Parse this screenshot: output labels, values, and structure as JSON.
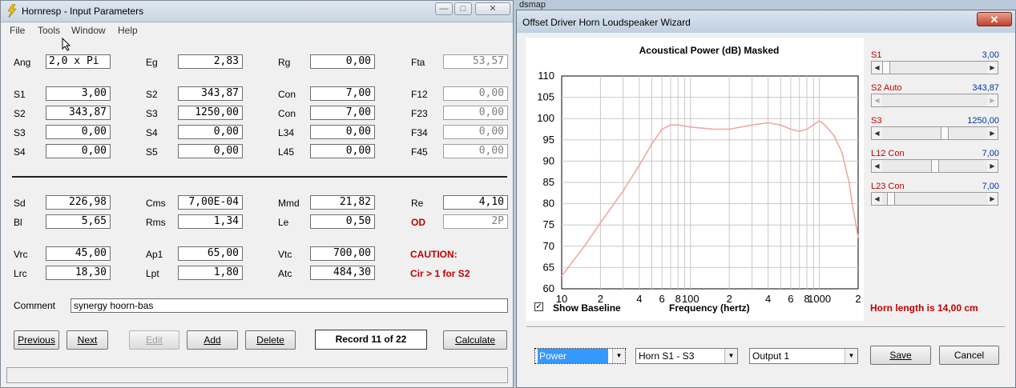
{
  "left": {
    "title": "Hornresp - Input Parameters",
    "menu": [
      "File",
      "Tools",
      "Window",
      "Help"
    ],
    "rows": [
      [
        {
          "label": "Ang",
          "value": "2,0 x Pi",
          "mono": true,
          "align": "left"
        },
        {
          "label": "Eg",
          "value": "2,83"
        },
        {
          "label": "Rg",
          "value": "0,00"
        },
        {
          "label": "Fta",
          "value": "53,57",
          "ro": true
        }
      ],
      [
        {
          "label": "S1",
          "value": "3,00"
        },
        {
          "label": "S2",
          "value": "343,87"
        },
        {
          "label": "Con",
          "value": "7,00"
        },
        {
          "label": "F12",
          "value": "0,00",
          "ro": true
        }
      ],
      [
        {
          "label": "S2",
          "value": "343,87"
        },
        {
          "label": "S3",
          "value": "1250,00"
        },
        {
          "label": "Con",
          "value": "7,00"
        },
        {
          "label": "F23",
          "value": "0,00",
          "ro": true
        }
      ],
      [
        {
          "label": "S3",
          "value": "0,00"
        },
        {
          "label": "S4",
          "value": "0,00"
        },
        {
          "label": "L34",
          "value": "0,00"
        },
        {
          "label": "F34",
          "value": "0,00",
          "ro": true
        }
      ],
      [
        {
          "label": "S4",
          "value": "0,00"
        },
        {
          "label": "S5",
          "value": "0,00"
        },
        {
          "label": "L45",
          "value": "0,00"
        },
        {
          "label": "F45",
          "value": "0,00",
          "ro": true
        }
      ],
      [
        {
          "label": "Sd",
          "value": "226,98"
        },
        {
          "label": "Cms",
          "value": "7,00E-04"
        },
        {
          "label": "Mmd",
          "value": "21,82"
        },
        {
          "label": "Re",
          "value": "4,10"
        }
      ],
      [
        {
          "label": "Bl",
          "value": "5,65"
        },
        {
          "label": "Rms",
          "value": "1,34"
        },
        {
          "label": "Le",
          "value": "0,50"
        },
        {
          "label": "OD",
          "value": "2P",
          "ro": true,
          "red": true
        }
      ],
      [
        {
          "label": "Vrc",
          "value": "45,00"
        },
        {
          "label": "Ap1",
          "value": "65,00"
        },
        {
          "label": "Vtc",
          "value": "700,00"
        }
      ],
      [
        {
          "label": "Lrc",
          "value": "18,30"
        },
        {
          "label": "Lpt",
          "value": "1,80"
        },
        {
          "label": "Atc",
          "value": "484,30"
        }
      ]
    ],
    "caution": "CAUTION:",
    "caution_detail": "Cir > 1 for S2",
    "comment_label": "Comment",
    "comment_value": "synergy hoorn-bas",
    "buttons": {
      "previous": "Previous",
      "next": "Next",
      "edit": "Edit",
      "add": "Add",
      "delete": "Delete",
      "calculate": "Calculate"
    },
    "record": "Record 11 of 22"
  },
  "right": {
    "title": "Offset Driver Horn Loudspeaker Wizard",
    "chart_title": "Acoustical Power (dB)   Masked",
    "xlabel": "Frequency (hertz)",
    "show_baseline": "Show Baseline",
    "horn_length": "Horn length is 14,00 cm",
    "sliders": [
      {
        "label": "S1",
        "value": "3,00",
        "position": 0.0
      },
      {
        "label": "S2  Auto",
        "value": "343,87",
        "position": 0.0,
        "disabled": true
      },
      {
        "label": "S3",
        "value": "1250,00",
        "position": 0.6
      },
      {
        "label": "L12  Con",
        "value": "7,00",
        "position": 0.5
      },
      {
        "label": "L23  Con",
        "value": "7,00",
        "position": 0.05
      }
    ],
    "combos": [
      {
        "name": "power-combo",
        "value": "Power",
        "selected": true
      },
      {
        "name": "horn-combo",
        "value": "Horn S1 - S3"
      },
      {
        "name": "output-combo",
        "value": "Output 1"
      }
    ],
    "save": "Save",
    "cancel": "Cancel"
  },
  "background": {
    "label": "dsmap"
  },
  "colors": {
    "curve": "#f0a8a0",
    "red_text": "#c00000",
    "blue_text": "#0033aa"
  },
  "chart_data": {
    "type": "line",
    "title": "Acoustical Power (dB)   Masked",
    "xlabel": "Frequency (hertz)",
    "ylabel": "",
    "xscale": "log",
    "xlim": [
      10,
      2000
    ],
    "ylim": [
      60,
      110
    ],
    "yticks": [
      60,
      65,
      70,
      75,
      80,
      85,
      90,
      95,
      100,
      105,
      110
    ],
    "xticks": [
      {
        "v": 10,
        "t": "10"
      },
      {
        "v": 20,
        "t": "2"
      },
      {
        "v": 40,
        "t": "4"
      },
      {
        "v": 60,
        "t": "6"
      },
      {
        "v": 80,
        "t": "8"
      },
      {
        "v": 100,
        "t": "100"
      },
      {
        "v": 200,
        "t": "2"
      },
      {
        "v": 400,
        "t": "4"
      },
      {
        "v": 600,
        "t": "6"
      },
      {
        "v": 800,
        "t": "8"
      },
      {
        "v": 1000,
        "t": "1000"
      },
      {
        "v": 2000,
        "t": "2"
      }
    ],
    "grid": true,
    "series": [
      {
        "x": [
          10,
          15,
          20,
          30,
          40,
          50,
          60,
          70,
          80,
          100,
          150,
          200,
          300,
          400,
          500,
          600,
          700,
          800,
          900,
          1000,
          1100,
          1300,
          1500,
          1700,
          1800,
          1900,
          2000
        ],
        "y": [
          63,
          70,
          75.5,
          83,
          89,
          94,
          97.5,
          98.5,
          98.5,
          98,
          97.5,
          97.5,
          98.5,
          99,
          98.5,
          97.5,
          97,
          97.5,
          98.5,
          99.5,
          98.5,
          96,
          92,
          85,
          80,
          76,
          72
        ]
      }
    ]
  }
}
